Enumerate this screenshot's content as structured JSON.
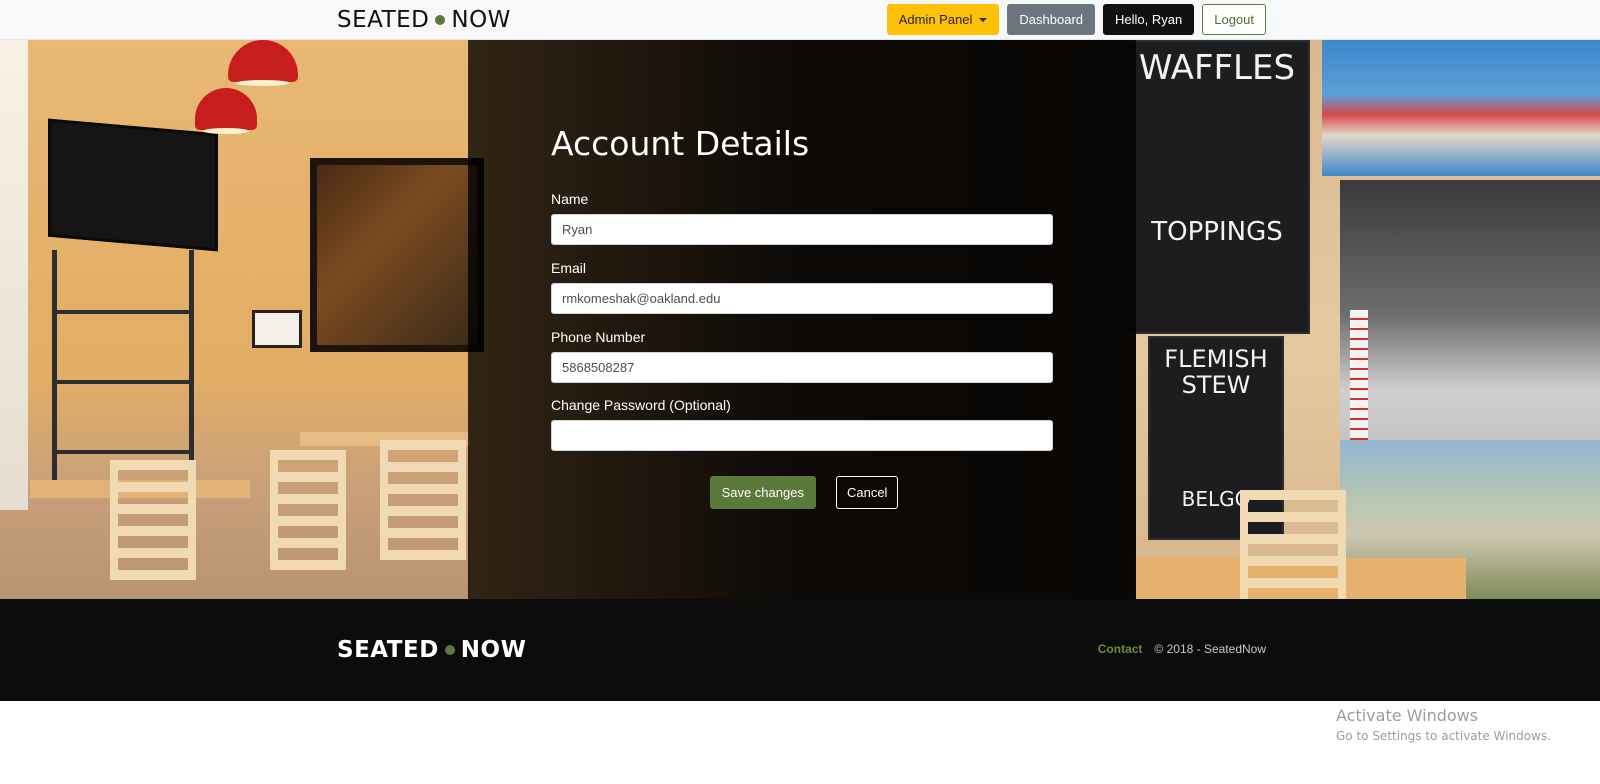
{
  "navbar": {
    "brand_left": "SEATED",
    "brand_right": "NOW",
    "admin_label": "Admin Panel",
    "dashboard_label": "Dashboard",
    "greeting_label": "Hello, Ryan",
    "logout_label": "Logout"
  },
  "form": {
    "title": "Account Details",
    "name_label": "Name",
    "name_value": "Ryan",
    "email_label": "Email",
    "email_value": "rmkomeshak@oakland.edu",
    "phone_label": "Phone Number",
    "phone_value": "5868508287",
    "password_label": "Change Password (Optional)",
    "password_value": "",
    "save_label": "Save changes",
    "cancel_label": "Cancel"
  },
  "footer": {
    "brand_left": "SEATED",
    "brand_right": "NOW",
    "contact_label": "Contact",
    "copyright": "© 2018 - SeatedNow"
  },
  "watermark": {
    "line1": "Activate Windows",
    "line2": "Go to Settings to activate Windows."
  },
  "background_chalkboard": {
    "board1_title": "WAFFLES",
    "board1_sub": "TOPPINGS",
    "board2_title": "FLEMISH STEW",
    "board2_sub": "BELGO"
  },
  "colors": {
    "brand_green": "#5b7a3a",
    "admin_yellow": "#ffc107",
    "dashboard_gray": "#6c757d",
    "footer_bg": "#0b0b0b"
  },
  "icons": {
    "admin_dropdown": "caret-down-icon",
    "brand_separator": "dot-icon"
  }
}
